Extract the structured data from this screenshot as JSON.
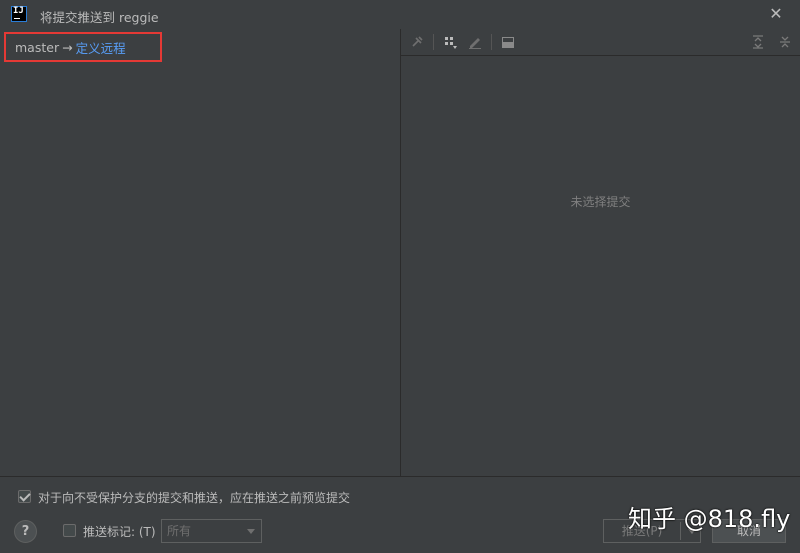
{
  "window": {
    "title": "将提交推送到 reggie",
    "app_icon_text": "IJ"
  },
  "branch": {
    "local": "master",
    "arrow": "→",
    "remote_link": "定义远程"
  },
  "details": {
    "empty_text": "未选择提交"
  },
  "footer": {
    "protected_checkbox": {
      "checked": true,
      "label": "对于向不受保护分支的提交和推送，应在推送之前预览提交"
    },
    "push_tags": {
      "checked": false,
      "label": "推送标记: (T)",
      "select_value": "所有"
    },
    "help_label": "?",
    "push_button": "推送(P)",
    "cancel_button": "取消"
  },
  "watermark": "知乎 @818.fly"
}
